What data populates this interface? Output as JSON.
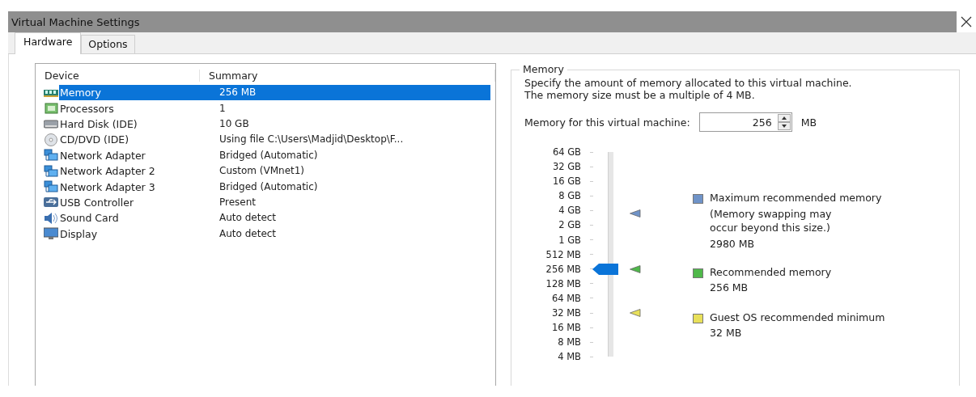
{
  "window": {
    "title": "Virtual Machine Settings"
  },
  "tabs": [
    {
      "label": "Hardware",
      "selected": true
    },
    {
      "label": "Options",
      "selected": false
    }
  ],
  "devices": {
    "columns": [
      "Device",
      "Summary"
    ],
    "rows": [
      {
        "kind": "memory",
        "device": "Memory",
        "summary": "256 MB",
        "selected": true
      },
      {
        "kind": "processor",
        "device": "Processors",
        "summary": "1",
        "selected": false
      },
      {
        "kind": "disk",
        "device": "Hard Disk (IDE)",
        "summary": "10 GB",
        "selected": false
      },
      {
        "kind": "cd",
        "device": "CD/DVD (IDE)",
        "summary": "Using file C:\\Users\\Madjid\\Desktop\\F...",
        "selected": false
      },
      {
        "kind": "network",
        "device": "Network Adapter",
        "summary": "Bridged (Automatic)",
        "selected": false
      },
      {
        "kind": "network",
        "device": "Network Adapter 2",
        "summary": "Custom (VMnet1)",
        "selected": false
      },
      {
        "kind": "network",
        "device": "Network Adapter 3",
        "summary": "Bridged (Automatic)",
        "selected": false
      },
      {
        "kind": "usb",
        "device": "USB Controller",
        "summary": "Present",
        "selected": false
      },
      {
        "kind": "sound",
        "device": "Sound Card",
        "summary": "Auto detect",
        "selected": false
      },
      {
        "kind": "display",
        "device": "Display",
        "summary": "Auto detect",
        "selected": false
      }
    ]
  },
  "memory": {
    "title": "Memory",
    "description": "Specify the amount of memory allocated to this virtual machine. The memory size must be a multiple of 4 MB.",
    "field_label": "Memory for this virtual machine:",
    "value": "256",
    "unit": "MB",
    "scale": [
      "64 GB",
      "32 GB",
      "16 GB",
      "8 GB",
      "4 GB",
      "2 GB",
      "1 GB",
      "512 MB",
      "256 MB",
      "128 MB",
      "64 MB",
      "32 MB",
      "16 MB",
      "8 MB",
      "4 MB"
    ],
    "slider": {
      "level": 0.4286
    },
    "legend": [
      {
        "label": "Maximum recommended memory",
        "note": "(Memory swapping may occur beyond this size.)",
        "value": "2980 MB",
        "color": "#6f93c8",
        "level": 0.7
      },
      {
        "label": "Recommended memory",
        "value": "256 MB",
        "color": "#4fb84a",
        "level": 0.4286
      },
      {
        "label": "Guest OS recommended minimum",
        "value": "32 MB",
        "color": "#e8e05a",
        "level": 0.2143
      }
    ]
  }
}
